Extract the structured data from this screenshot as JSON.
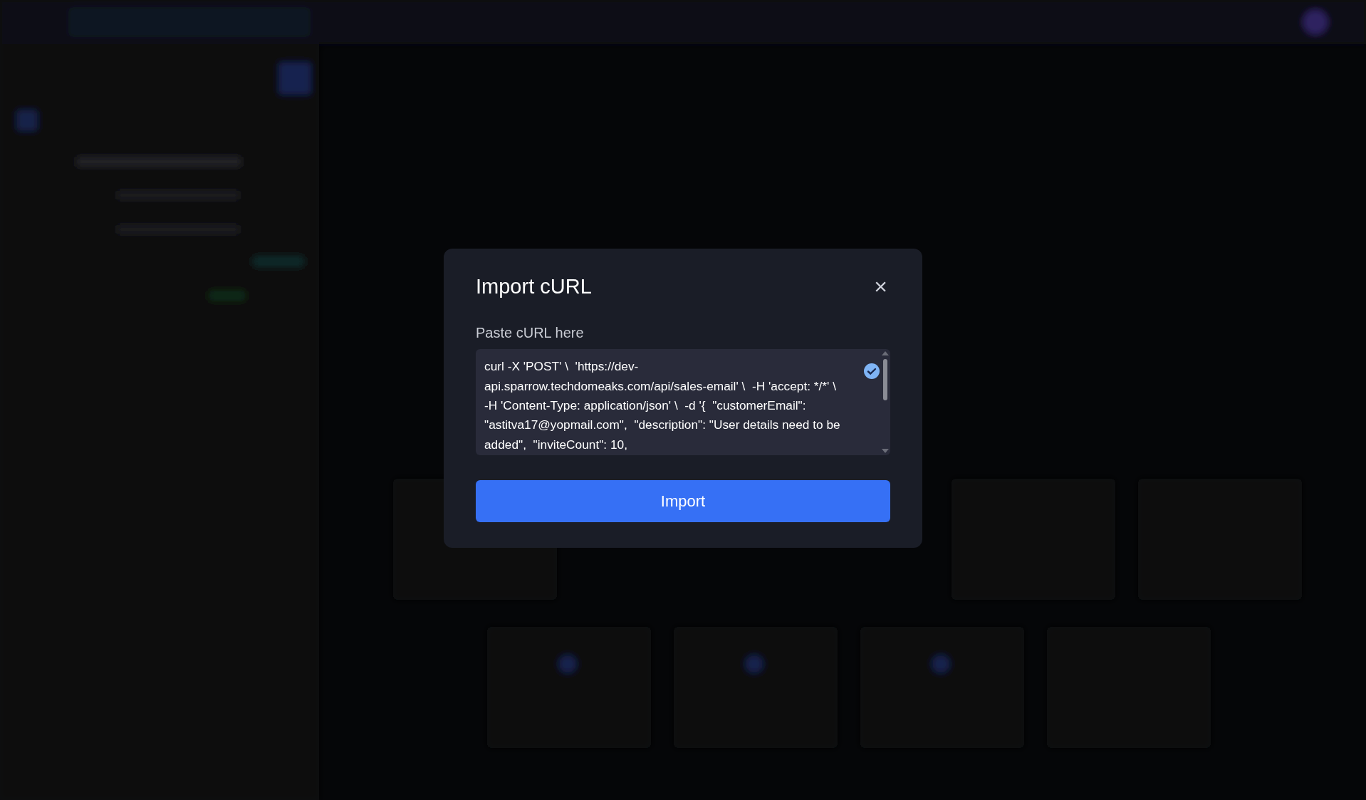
{
  "dialog": {
    "title": "Import cURL",
    "close": "×",
    "field_label": "Paste cURL here",
    "curl_text": "curl -X 'POST' \\  'https://dev-api.sparrow.techdomeaks.com/api/sales-email' \\  -H 'accept: */*' \\  -H 'Content-Type: application/json' \\  -d '{  \"customerEmail\": \"astitva17@yopmail.com\",  \"description\": \"User details need to be added\",  \"inviteCount\": 10,",
    "valid": true,
    "button": "Import"
  }
}
